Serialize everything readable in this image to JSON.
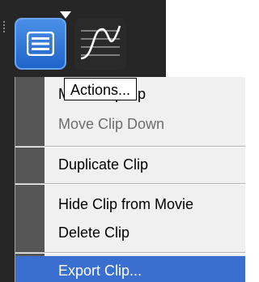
{
  "toolbar": {
    "actions_button_icon": "hamburger-menu-icon",
    "curve_button_icon": "bezier-curve-icon",
    "accent_color": "#2f7ad9"
  },
  "tooltip": {
    "text": "Actions..."
  },
  "menu": {
    "items": [
      {
        "label": "Move Clip Up",
        "enabled": true
      },
      {
        "label": "Move Clip Down",
        "enabled": false
      },
      {
        "label": "Duplicate Clip",
        "enabled": true
      },
      {
        "label": "Hide Clip from Movie",
        "enabled": true
      },
      {
        "label": "Delete Clip",
        "enabled": true
      },
      {
        "label": "Export Clip...",
        "enabled": true,
        "highlighted": true
      }
    ],
    "highlight_color": "#3a6fcf"
  }
}
